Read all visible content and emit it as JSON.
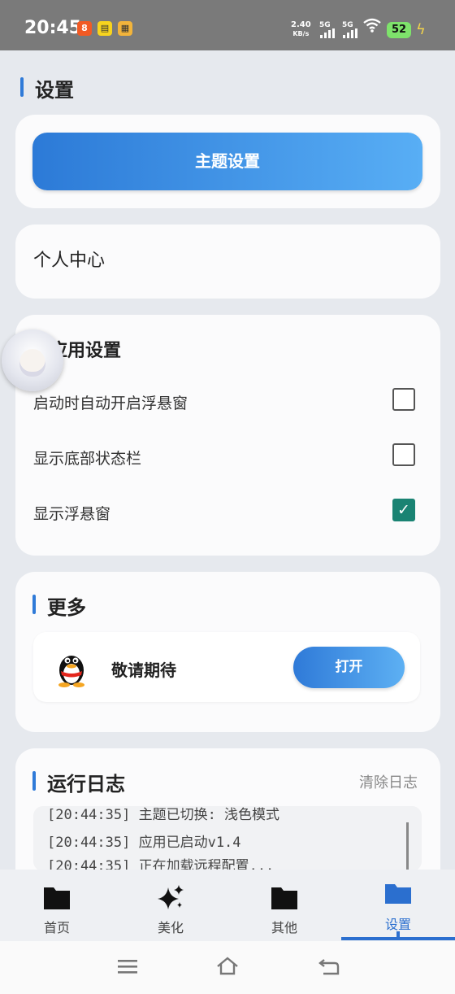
{
  "status_bar": {
    "time": "20:45",
    "net_speed": "2.40",
    "net_unit": "KB/s",
    "sig1": "5G",
    "sig2": "5G",
    "battery": "52",
    "app_icons": [
      "app-notify-icon",
      "app-yellow-icon",
      "app-game-icon"
    ]
  },
  "page": {
    "title": "设置"
  },
  "theme_card": {
    "button_label": "主题设置"
  },
  "profile_card": {
    "label": "个人中心"
  },
  "app_settings": {
    "title": "应用设置",
    "items": [
      {
        "label": "启动时自动开启浮悬窗",
        "checked": false
      },
      {
        "label": "显示底部状态栏",
        "checked": false
      },
      {
        "label": "显示浮悬窗",
        "checked": true
      }
    ],
    "check_mark": "✓"
  },
  "more": {
    "title": "更多",
    "item_label": "敬请期待",
    "item_icon": "qq-penguin-icon",
    "open_label": "打开"
  },
  "log": {
    "title": "运行日志",
    "clear_label": "清除日志",
    "lines": [
      "[20:44:35] 主题已切换: 浅色模式",
      "[20:44:35] 应用已启动v1.4",
      "[20:44:35] 正在加载远程配置..."
    ]
  },
  "bottom_nav": {
    "items": [
      {
        "label": "首页",
        "icon": "folder-icon"
      },
      {
        "label": "美化",
        "icon": "sparkle-icon"
      },
      {
        "label": "其他",
        "icon": "folder-icon"
      },
      {
        "label": "设置",
        "icon": "folder-icon"
      }
    ],
    "active_index": 3
  },
  "colors": {
    "accent": "#2f7ad8",
    "check_green": "#1a8373"
  }
}
